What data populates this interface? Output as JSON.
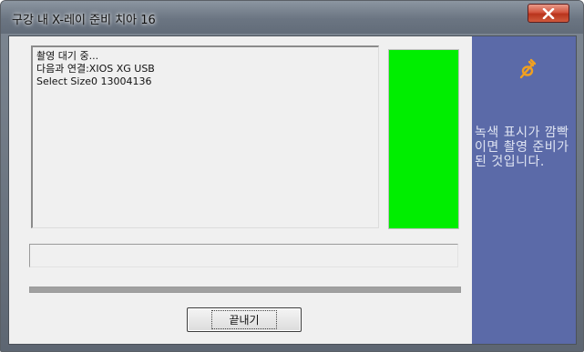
{
  "window": {
    "title": "구강 내 X-레이 준비 치아 16"
  },
  "log": {
    "lines": [
      "촬영 대기 중...",
      "다음과 연결:XIOS XG USB",
      "Select Size0 13004136"
    ]
  },
  "status": {
    "indicator_color": "#00ee00",
    "field_value": ""
  },
  "progress": {
    "value_fraction": 1.0
  },
  "buttons": {
    "exit_label": "끝내기"
  },
  "side_panel": {
    "icon": "plug-icon",
    "accent_color": "#f0a020",
    "background_color": "#5b6aa8",
    "message": "녹색 표시가 깜빡이면 촬영 준비가 된 것입니다."
  }
}
